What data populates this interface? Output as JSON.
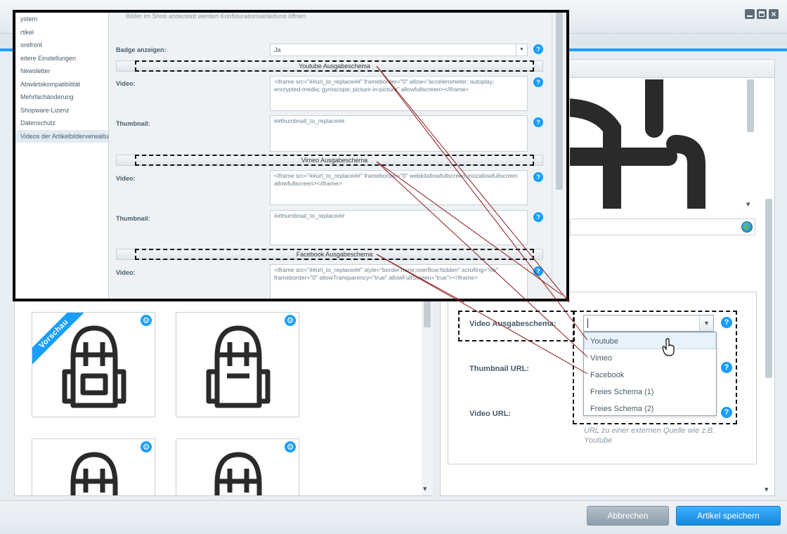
{
  "overlay": {
    "top_text": "Bilder im Shop angezeigt werden  Konfigurationsanleitung öffnen",
    "nav": [
      {
        "label": "ystem"
      },
      {
        "label": "rtikel"
      },
      {
        "label": "orefront"
      },
      {
        "label": "eitere Einstellungen"
      },
      {
        "label": "Newsletter"
      },
      {
        "label": "Abwärtskompatibilität"
      },
      {
        "label": "Mehrfachänderung"
      },
      {
        "label": "Shopware-Lizenz"
      },
      {
        "label": "Datenschutz"
      },
      {
        "label": "Videos der Artikelbilderverwaltung"
      }
    ],
    "badge_label": "Badge anzeigen:",
    "badge_value": "Ja",
    "youtube_header": "Youtube Ausgabeschema",
    "vimeo_header": "Vimeo Ausgabeschema",
    "facebook_header": "Facebook Ausgabeschema",
    "video_label": "Video:",
    "thumbnail_label": "Thumbnail:",
    "youtube_video": "<iframe src=\"##url_to_replace##\" frameborder=\"0\" allow=\"accelerometer; autoplay; encrypted-media; gyroscope; picture-in-picture\" allowfullscreen></iframe>",
    "youtube_thumb": "##thumbnail_to_replace##",
    "vimeo_video": "<iframe src=\"##url_to_replace##\" frameborder=\"0\" webkitallowfullscreen mozallowfullscreen allowfullscreen></iframe>",
    "vimeo_thumb": "##thumbnail_to_replace##",
    "facebook_video": "<iframe src=\"##url_to_replace##\" style=\"border:none;overflow:hidden\" scrolling=\"no\" frameborder=\"0\" allowTransparency=\"true\" allowFullScreen=\"true\"></iframe>"
  },
  "help_glyph": "?",
  "gear_glyph": "⚙",
  "preview_ribbon": "Vorschau",
  "right": {
    "video_schema_label": "Video Ausgabeschema:",
    "thumbnail_url_label": "Thumbnail URL:",
    "video_url_label": "Video URL:",
    "combo_value": "",
    "combo_trigger": "▼",
    "options": [
      "Youtube",
      "Vimeo",
      "Facebook",
      "Freies Schema (1)",
      "Freies Schema (2)"
    ],
    "hint": "URL zu einer externen Quelle wie z.B. Youtube"
  },
  "buttons": {
    "cancel": "Abbrechen",
    "save": "Artikel speichern"
  },
  "window": {
    "close_glyph": "×"
  },
  "colors": {
    "accent": "#189eff",
    "annotation_line": "#8b1a1a"
  }
}
